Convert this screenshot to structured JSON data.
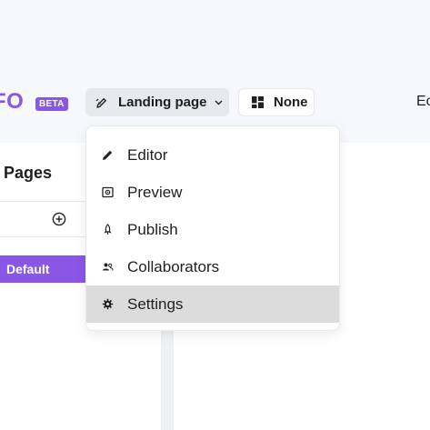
{
  "header": {
    "logo_text": "FO",
    "beta_badge": "BETA",
    "page_selector": {
      "label": "Landing page",
      "icon": "edit-pencil-icon"
    },
    "layout_selector": {
      "label": "None",
      "icon": "grid-icon"
    },
    "edge_text": "Ec"
  },
  "sidebar": {
    "title": "Pages",
    "add_icon": "plus-circle-icon",
    "items": [
      {
        "label": "Default"
      }
    ]
  },
  "dropdown": {
    "items": [
      {
        "label": "Editor",
        "icon": "pencil-icon"
      },
      {
        "label": "Preview",
        "icon": "preview-icon"
      },
      {
        "label": "Publish",
        "icon": "rocket-icon"
      },
      {
        "label": "Collaborators",
        "icon": "users-icon"
      },
      {
        "label": "Settings",
        "icon": "gear-icon",
        "highlighted": true
      }
    ]
  },
  "colors": {
    "brand": "#8a56e6",
    "highlight": "#dcdcdc",
    "header_bg": "#f6f8fc"
  }
}
